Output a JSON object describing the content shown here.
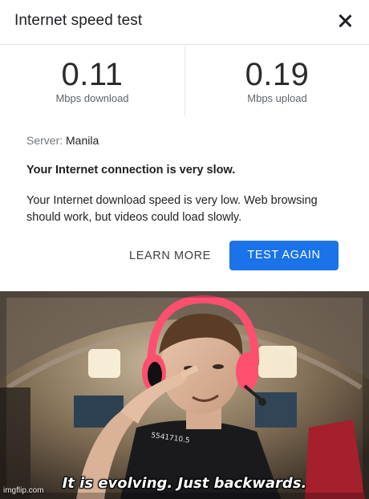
{
  "dialog": {
    "title": "Internet speed test",
    "close_icon": "close-icon"
  },
  "metrics": {
    "download": {
      "value": "0.11",
      "unit": "Mbps download"
    },
    "upload": {
      "value": "0.19",
      "unit": "Mbps upload"
    }
  },
  "server": {
    "label": "Server:",
    "name": "Manila"
  },
  "status": "Your Internet connection is very slow.",
  "description": "Your Internet download speed is very low. Web browsing should work, but videos could load slowly.",
  "actions": {
    "learn_more": "LEARN MORE",
    "test_again": "TEST AGAIN"
  },
  "meme": {
    "caption": "It is evolving. Just backwards.",
    "watermark": "imgflip.com",
    "shirt_text": "5541710.5"
  },
  "colors": {
    "primary_button": "#1a73e8",
    "headphones": "#ff4f6e"
  }
}
